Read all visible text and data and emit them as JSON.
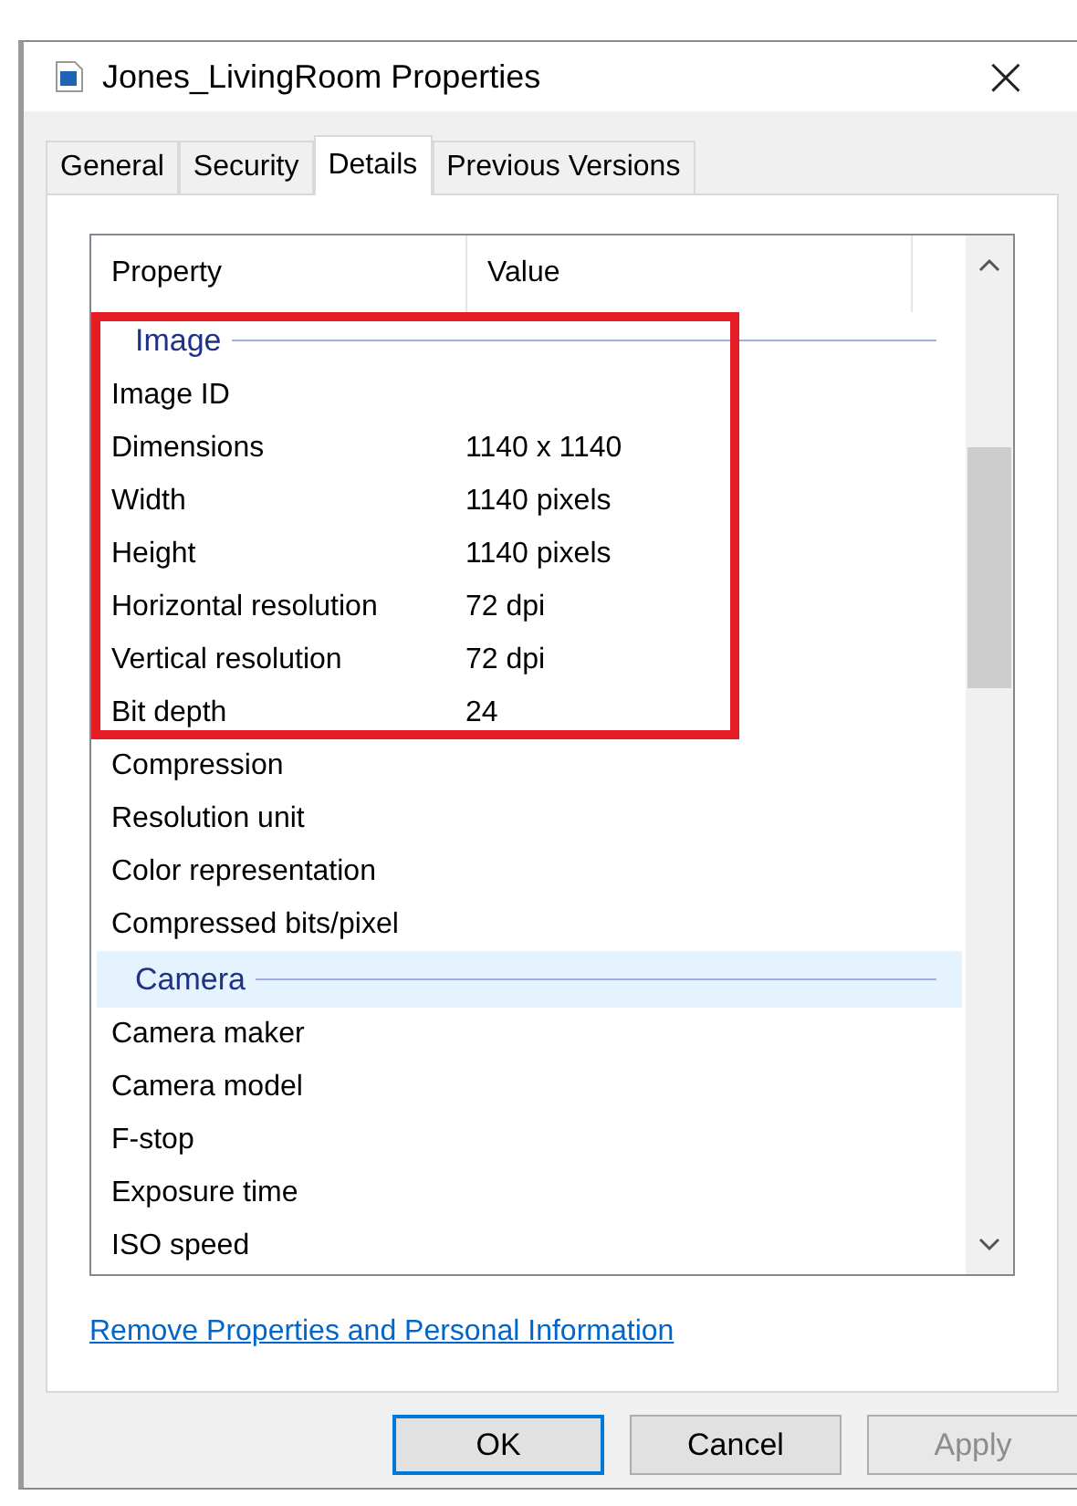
{
  "window": {
    "title": "Jones_LivingRoom Properties",
    "close": "×"
  },
  "tabs": [
    {
      "label": "General",
      "selected": false
    },
    {
      "label": "Security",
      "selected": false
    },
    {
      "label": "Details",
      "selected": true
    },
    {
      "label": "Previous Versions",
      "selected": false
    }
  ],
  "columns": [
    "Property",
    "Value"
  ],
  "blocks": [
    {
      "framed": true,
      "rows": [
        {
          "kind": "group",
          "label": "Image",
          "highlighted": false
        },
        {
          "kind": "item",
          "property": "Image ID",
          "value": ""
        },
        {
          "kind": "item",
          "property": "Dimensions",
          "value": "1140 x 1140"
        },
        {
          "kind": "item",
          "property": "Width",
          "value": "1140 pixels"
        },
        {
          "kind": "item",
          "property": "Height",
          "value": "1140 pixels"
        },
        {
          "kind": "item",
          "property": "Horizontal resolution",
          "value": "72 dpi"
        },
        {
          "kind": "item",
          "property": "Vertical resolution",
          "value": "72 dpi"
        },
        {
          "kind": "item",
          "property": "Bit depth",
          "value": "24"
        }
      ]
    },
    {
      "framed": false,
      "rows": [
        {
          "kind": "item",
          "property": "Compression",
          "value": ""
        },
        {
          "kind": "item",
          "property": "Resolution unit",
          "value": ""
        },
        {
          "kind": "item",
          "property": "Color representation",
          "value": ""
        },
        {
          "kind": "item",
          "property": "Compressed bits/pixel",
          "value": ""
        },
        {
          "kind": "group",
          "label": "Camera",
          "highlighted": true
        },
        {
          "kind": "item",
          "property": "Camera maker",
          "value": ""
        },
        {
          "kind": "item",
          "property": "Camera model",
          "value": ""
        },
        {
          "kind": "item",
          "property": "F-stop",
          "value": ""
        },
        {
          "kind": "item",
          "property": "Exposure time",
          "value": ""
        },
        {
          "kind": "item",
          "property": "ISO speed",
          "value": ""
        }
      ]
    }
  ],
  "link": "Remove Properties and Personal Information",
  "buttons": [
    {
      "label": "OK",
      "default": true,
      "disabled": false
    },
    {
      "label": "Cancel",
      "default": false,
      "disabled": false
    },
    {
      "label": "Apply",
      "default": false,
      "disabled": true
    }
  ]
}
